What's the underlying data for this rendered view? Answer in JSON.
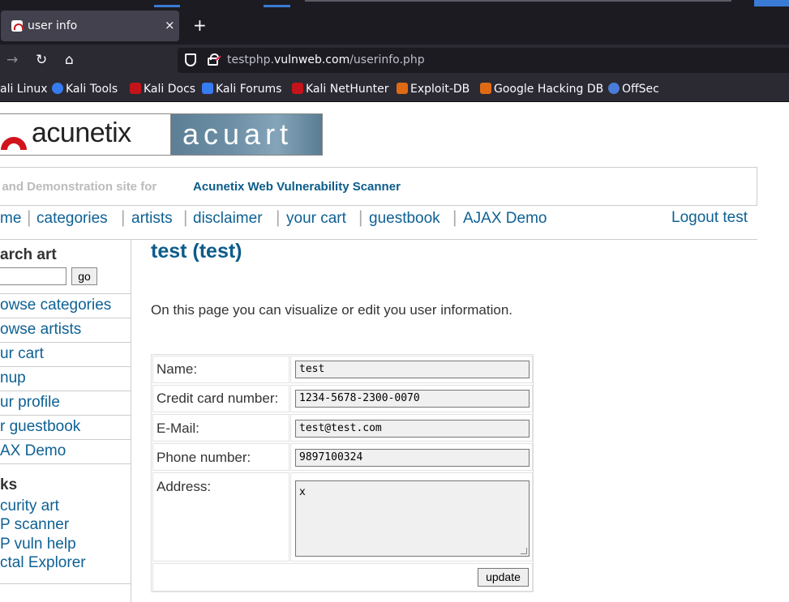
{
  "browser": {
    "tab_title": "user info",
    "close_glyph": "×",
    "newtab_glyph": "+",
    "url_host_prefix": "testphp.",
    "url_host_main": "vulnweb.com",
    "url_path": "/userinfo.php",
    "nav_icons": [
      "back-arrow-icon",
      "forward-arrow-icon",
      "reload-icon",
      "home-icon"
    ],
    "bookmarks": [
      {
        "label": "ali Linux",
        "icon": "kali-icon",
        "color": "#367bf0"
      },
      {
        "label": "Kali Tools",
        "icon": "kali-tools-icon",
        "color": "#367bf0"
      },
      {
        "label": "Kali Docs",
        "icon": "kali-docs-icon",
        "color": "#c4141b"
      },
      {
        "label": "Kali Forums",
        "icon": "kali-forums-icon",
        "color": "#367bf0"
      },
      {
        "label": "Kali NetHunter",
        "icon": "nethunter-icon",
        "color": "#c4141b"
      },
      {
        "label": "Exploit-DB",
        "icon": "exploitdb-icon",
        "color": "#e06a14"
      },
      {
        "label": "Google Hacking DB",
        "icon": "ghdb-icon",
        "color": "#e06a14"
      },
      {
        "label": "OffSec",
        "icon": "offsec-icon",
        "color": "#4b7bd8"
      }
    ]
  },
  "site": {
    "logo_left": "acunetix",
    "logo_right": "acuart",
    "tagline_prefix": "ST and Demonstration site for",
    "tagline_link": "Acunetix Web Vulnerability Scanner",
    "menu": [
      "me",
      "categories",
      "artists",
      "disclaimer",
      "your cart",
      "guestbook",
      "AJAX Demo"
    ],
    "menu_separator": "|",
    "logout": "Logout test",
    "accent_color": "#0e6194"
  },
  "sidebar": {
    "search_heading": "arch art",
    "go_label": "go",
    "items": [
      "owse categories",
      "owse artists",
      "ur cart",
      "nup",
      "ur profile",
      "r guestbook",
      "AX Demo"
    ],
    "links_heading": "ks",
    "links": [
      "curity art",
      "P scanner",
      "P vuln help",
      "ctal Explorer"
    ]
  },
  "content": {
    "title": "test (test)",
    "intro": "On this page you can visualize or edit you user information.",
    "form": {
      "name_label": "Name:",
      "name_value": "test",
      "cc_label": "Credit card number:",
      "cc_value": "1234-5678-2300-0070",
      "email_label": "E-Mail:",
      "email_value": "test@test.com",
      "phone_label": "Phone number:",
      "phone_value": "9897100324",
      "address_label": "Address:",
      "address_value": "x",
      "update_label": "update"
    }
  }
}
